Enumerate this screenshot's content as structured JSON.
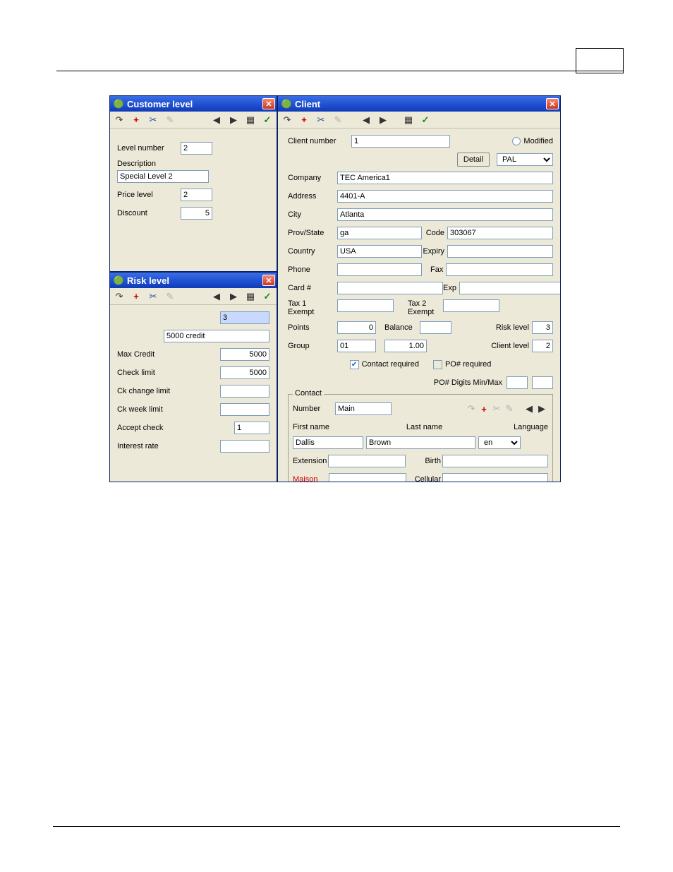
{
  "customer_level": {
    "title": "Customer level",
    "level_number_label": "Level number",
    "level_number": "2",
    "description_label": "Description",
    "description": "Special Level 2",
    "price_level_label": "Price level",
    "price_level": "2",
    "discount_label": "Discount",
    "discount": "5"
  },
  "risk_level": {
    "title": "Risk level",
    "id": "3",
    "desc": "5000 credit",
    "max_credit_label": "Max Credit",
    "max_credit": "5000",
    "check_limit_label": "Check limit",
    "check_limit": "5000",
    "ck_change_limit_label": "Ck change limit",
    "ck_change_limit": "",
    "ck_week_limit_label": "Ck week limit",
    "ck_week_limit": "",
    "accept_check_label": "Accept check",
    "accept_check": "1",
    "interest_rate_label": "Interest rate",
    "interest_rate": ""
  },
  "client": {
    "title": "Client",
    "client_number_label": "Client number",
    "client_number": "1",
    "modified_label": "Modified",
    "detail_label": "Detail",
    "pal_value": "PAL",
    "company_label": "Company",
    "company": "TEC America1",
    "address_label": "Address",
    "address": "4401-A",
    "city_label": "City",
    "city": "Atlanta",
    "prov_state_label": "Prov/State",
    "prov_state": "ga",
    "code_label": "Code",
    "code": "303067",
    "country_label": "Country",
    "country": "USA",
    "expiry_label": "Expiry",
    "expiry": "",
    "phone_label": "Phone",
    "phone": "",
    "fax_label": "Fax",
    "fax": "",
    "card_label": "Card #",
    "card": "",
    "exp_label": "Exp",
    "exp": "",
    "tax1_label": "Tax 1\nExempt",
    "tax1": "",
    "tax2_label": "Tax 2\nExempt",
    "tax2": "",
    "points_label": "Points",
    "points": "0",
    "balance_label": "Balance",
    "balance": "",
    "risk_level_label": "Risk level",
    "risk_level": "3",
    "group_label": "Group",
    "group": "01",
    "group_val": "1.00",
    "client_level_label": "Client level",
    "client_level": "2",
    "contact_required_label": "Contact required",
    "po_required_label": "PO# required",
    "po_digits_label": "PO# Digits  Min/Max",
    "po_min": "",
    "po_max": "",
    "contact": {
      "legend": "Contact",
      "number_label": "Number",
      "number": "Main",
      "first_name_label": "First name",
      "last_name_label": "Last name",
      "language_label": "Language",
      "first_name": "Dallis",
      "last_name": "Brown",
      "language": "en",
      "extension_label": "Extension",
      "extension": "",
      "birth_label": "Birth",
      "birth": "",
      "maison_label": "Maison",
      "maison": "",
      "cellular_label": "Cellular",
      "cellular": ""
    }
  }
}
